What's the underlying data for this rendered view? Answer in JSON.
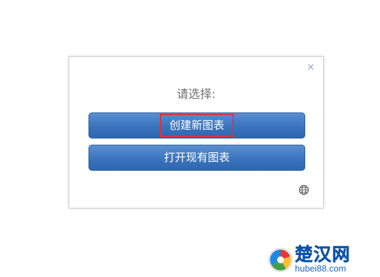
{
  "dialog": {
    "close_label": "×",
    "prompt": "请选择:",
    "create_button_label": "创建新图表",
    "open_button_label": "打开现有图表",
    "globe_icon": "globe-icon"
  },
  "watermark": {
    "brand": "楚汉网",
    "url": "hubei88.com"
  },
  "colors": {
    "button_blue": "#3a74be",
    "highlight_red": "#d8343f",
    "watermark_blue": "#1b66c4"
  }
}
